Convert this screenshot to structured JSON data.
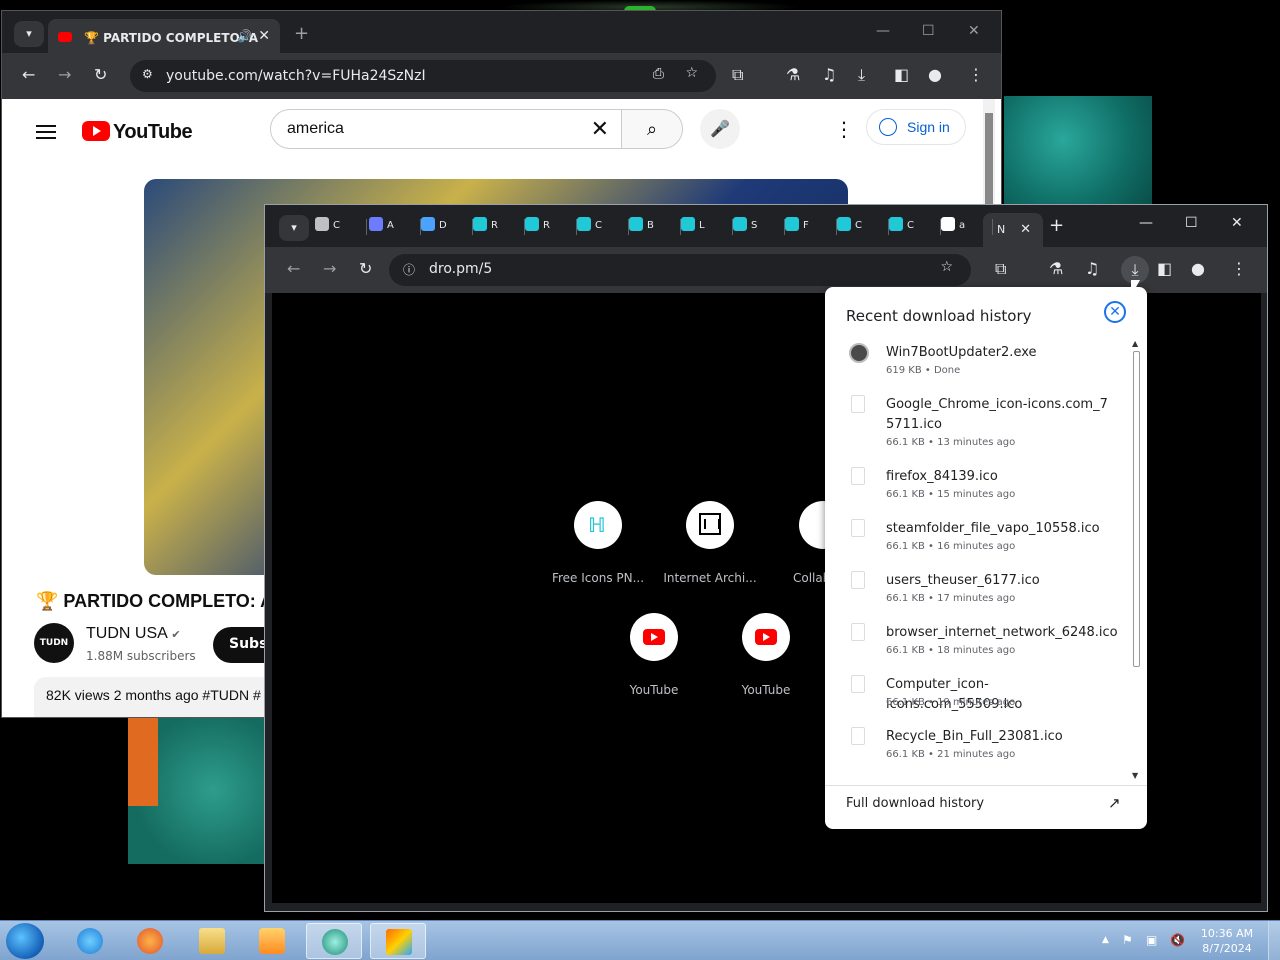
{
  "back_window": {
    "tab_title": "🏆 PARTIDO COMPLETO: A",
    "new_tab": "+",
    "url": "youtube.com/watch?v=FUHa24SzNzI",
    "window_controls": {
      "minimize": "—",
      "maximize": "☐",
      "close": "✕"
    }
  },
  "youtube": {
    "logo_text": "YouTube",
    "search_value": "america",
    "sign_in": "Sign in",
    "video_title": "🏆 PARTIDO COMPLETO: A",
    "channel_name": "TUDN USA",
    "channel_avatar": "TUDN",
    "verified": "✔",
    "subscribers": "1.88M subscribers",
    "subscribe": "Subsc",
    "desc_line": "82K views  2 months ago  #TUDN #"
  },
  "front_window": {
    "url": "dro.pm/5",
    "active_tab_letter": "N",
    "tabs": [
      {
        "letter": "C",
        "icon": "feather-icon",
        "color": "#bdc1c6"
      },
      {
        "letter": "A",
        "icon": "robot-icon",
        "color": "#6c7cff"
      },
      {
        "letter": "D",
        "icon": "download-arrow-icon",
        "color": "#4aa3ff"
      },
      {
        "letter": "R",
        "icon": "freeicons-icon",
        "color": "#21c8d8"
      },
      {
        "letter": "R",
        "icon": "freeicons-icon",
        "color": "#21c8d8"
      },
      {
        "letter": "C",
        "icon": "freeicons-icon",
        "color": "#21c8d8"
      },
      {
        "letter": "B",
        "icon": "freeicons-icon",
        "color": "#21c8d8"
      },
      {
        "letter": "L",
        "icon": "freeicons-icon",
        "color": "#21c8d8"
      },
      {
        "letter": "S",
        "icon": "freeicons-icon",
        "color": "#21c8d8"
      },
      {
        "letter": "F",
        "icon": "freeicons-icon",
        "color": "#21c8d8"
      },
      {
        "letter": "C",
        "icon": "freeicons-icon",
        "color": "#21c8d8"
      },
      {
        "letter": "C",
        "icon": "freeicons-icon",
        "color": "#21c8d8"
      },
      {
        "letter": "a",
        "icon": "google-icon",
        "color": "#ffffff"
      }
    ],
    "shortcuts": [
      {
        "label": "Free Icons PN...",
        "icon": "freeicons-icon"
      },
      {
        "label": "Internet Archi...",
        "icon": "archive-icon"
      },
      {
        "label": "CollabVM",
        "icon": "collabvm-icon"
      },
      {
        "label": "YouTube",
        "icon": "youtube-icon"
      },
      {
        "label": "YouTube",
        "icon": "youtube-icon"
      }
    ]
  },
  "downloads": {
    "title": "Recent download history",
    "footer": "Full download history",
    "items": [
      {
        "name": "Win7BootUpdater2.exe",
        "meta": "619 KB • Done"
      },
      {
        "name": "Google_Chrome_icon-icons.com_75711.ico",
        "meta": "66.1 KB • 13 minutes ago"
      },
      {
        "name": "firefox_84139.ico",
        "meta": "66.1 KB • 15 minutes ago"
      },
      {
        "name": "steamfolder_file_vapo_10558.ico",
        "meta": "66.1 KB • 16 minutes ago"
      },
      {
        "name": "users_theuser_6177.ico",
        "meta": "66.1 KB • 17 minutes ago"
      },
      {
        "name": "browser_internet_network_6248.ico",
        "meta": "66.1 KB • 18 minutes ago"
      },
      {
        "name": "Computer_icon-icons.com_55509.ico",
        "meta": "66.1 KB • 19 minutes ago"
      },
      {
        "name": "Recycle_Bin_Full_23081.ico",
        "meta": "66.1 KB • 21 minutes ago"
      }
    ]
  },
  "taskbar": {
    "time": "10:36 AM",
    "date": "8/7/2024",
    "apps": [
      "internet-explorer-icon",
      "firefox-icon",
      "file-explorer-icon",
      "media-player-icon",
      "chrome-remote-icon",
      "paint-icon"
    ]
  }
}
